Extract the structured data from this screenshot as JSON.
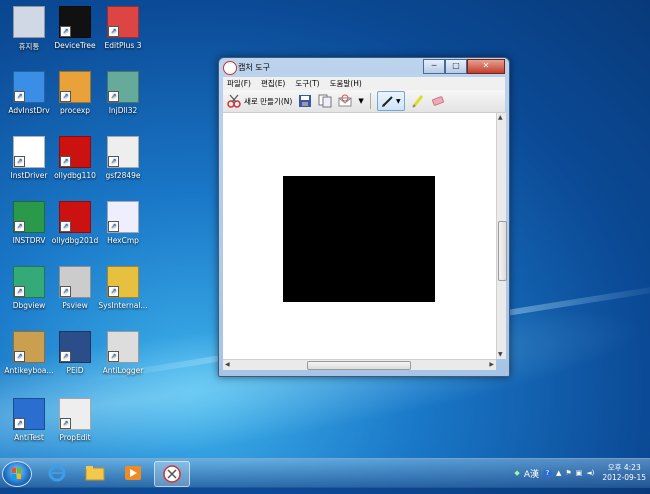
{
  "desktop": {
    "icons": [
      {
        "label": "휴지통",
        "icon": "recycle-bin-icon"
      },
      {
        "label": "DeviceTree",
        "icon": "devicetree-icon"
      },
      {
        "label": "EditPlus 3",
        "icon": "editplus-icon"
      },
      {
        "label": "AdvInstDrv",
        "icon": "gear-icon"
      },
      {
        "label": "procexp",
        "icon": "windows-flag-icon"
      },
      {
        "label": "InjDll32",
        "icon": "window-app-icon"
      },
      {
        "label": "InstDriver",
        "icon": "inst-drv-icon"
      },
      {
        "label": "ollydbg110",
        "icon": "ollydbg-bug-icon"
      },
      {
        "label": "gsf2849e",
        "icon": "gmer-icon"
      },
      {
        "label": "INSTDRV",
        "icon": "instdrv-green-icon"
      },
      {
        "label": "ollydbg201d",
        "icon": "ollydbg-bug-icon"
      },
      {
        "label": "HexCmp",
        "icon": "hexcmp-icon"
      },
      {
        "label": "Dbgview",
        "icon": "bug-icon"
      },
      {
        "label": "Psview",
        "icon": "magnifier-icon"
      },
      {
        "label": "SysInternal...",
        "icon": "folder-icon"
      },
      {
        "label": "Antikeyboa...",
        "icon": "keyboard-icon"
      },
      {
        "label": "PEiD",
        "icon": "peid-icon"
      },
      {
        "label": "AntiLogger",
        "icon": "antilogger-icon"
      },
      {
        "label": "AntiTest",
        "icon": "shield-icon"
      },
      {
        "label": "PropEdit",
        "icon": "propedit-icon"
      }
    ]
  },
  "window": {
    "title": "캡처 도구",
    "menu": [
      "파일(F)",
      "편집(E)",
      "도구(T)",
      "도움말(H)"
    ],
    "toolbar": {
      "new_capture": "새로 만들기(N)"
    },
    "caption_min": "─",
    "caption_max": "□",
    "caption_close": "✕"
  },
  "taskbar": {
    "apps": [
      "internet-explorer-icon",
      "explorer-folder-icon",
      "media-player-icon",
      "snipping-tool-icon"
    ],
    "tray": {
      "ime": "A漢",
      "time": "오후 4:23",
      "date": "2012-09-15"
    }
  },
  "colors": {
    "accent": "#1a78c8",
    "canvas": "#ffffff",
    "capture_fill": "#000000"
  }
}
